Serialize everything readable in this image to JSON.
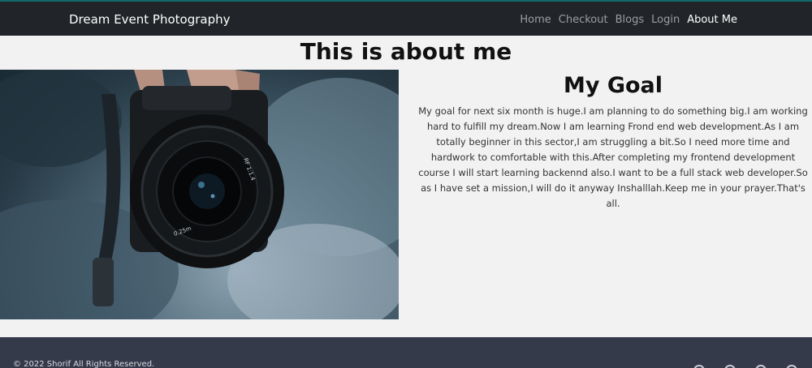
{
  "navbar": {
    "brand": "Dream Event Photography",
    "links": [
      {
        "label": "Home",
        "active": false
      },
      {
        "label": "Checkout",
        "active": false
      },
      {
        "label": "Blogs",
        "active": false
      },
      {
        "label": "Login",
        "active": false
      },
      {
        "label": "About Me",
        "active": true
      }
    ]
  },
  "main": {
    "heading": "This is about me",
    "photo_icon": "camera-photo",
    "goal": {
      "title": "My Goal",
      "text": "My goal for next six month is huge.I am planning to do something big.I am working hard to fulfill my dream.Now I am learning Frond end web development.As I am totally beginner in this sector,I am struggling a bit.So I need more time and hardwork to comfortable with this.After completing my frontend development course I will start learning backennd also.I want to be a full stack web developer.So as I have set a mission,I will do it anyway Inshalllah.Keep me in your prayer.That's all."
    }
  },
  "footer": {
    "copyright": "© 2022 Shorif All Rights Reserved.",
    "social_icons": [
      "facebook-icon",
      "twitter-icon",
      "instagram-icon",
      "linkedin-icon"
    ]
  },
  "colors": {
    "navbar_bg": "#212529",
    "page_bg": "#f2f2f2",
    "footer_bg": "#343a4a"
  }
}
